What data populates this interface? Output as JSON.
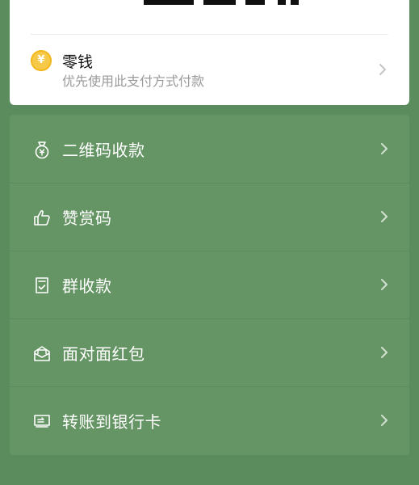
{
  "balance_option": {
    "title": "零钱",
    "subtitle": "优先使用此支付方式付款",
    "icon": "coin-yuan-icon",
    "coin_symbol": "¥"
  },
  "services": [
    {
      "label": "二维码收款",
      "icon": "money-bag-icon"
    },
    {
      "label": "赞赏码",
      "icon": "thumbs-up-icon"
    },
    {
      "label": "群收款",
      "icon": "group-receipt-icon"
    },
    {
      "label": "面对面红包",
      "icon": "red-envelope-icon"
    },
    {
      "label": "转账到银行卡",
      "icon": "bank-card-transfer-icon"
    }
  ],
  "colors": {
    "background": "#5a8c5e",
    "panel": "#659564",
    "coin": "#f7c948"
  }
}
